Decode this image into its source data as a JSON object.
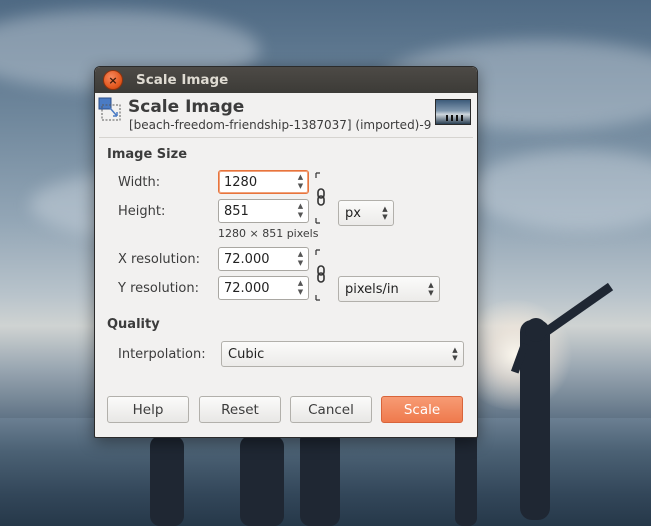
{
  "window": {
    "title": "Scale Image"
  },
  "header": {
    "title": "Scale Image",
    "subtitle": "[beach-freedom-friendship-1387037] (imported)-9"
  },
  "image_size": {
    "section_label": "Image Size",
    "width_label": "Width:",
    "width_value": "1280",
    "height_label": "Height:",
    "height_value": "851",
    "unit": "px",
    "pixel_summary": "1280 × 851 pixels",
    "xres_label": "X resolution:",
    "xres_value": "72.000",
    "yres_label": "Y resolution:",
    "yres_value": "72.000",
    "res_unit": "pixels/in"
  },
  "quality": {
    "section_label": "Quality",
    "interpolation_label": "Interpolation:",
    "interpolation_value": "Cubic"
  },
  "buttons": {
    "help": "Help",
    "reset": "Reset",
    "cancel": "Cancel",
    "scale": "Scale"
  },
  "colors": {
    "accent": "#ef7a4d",
    "titlebar": "#3c3b37",
    "focus": "#e8743c"
  },
  "icons": [
    "close-icon",
    "scale-image-icon",
    "chain-link-icon",
    "spin-arrows-icon",
    "combo-arrows-icon"
  ]
}
